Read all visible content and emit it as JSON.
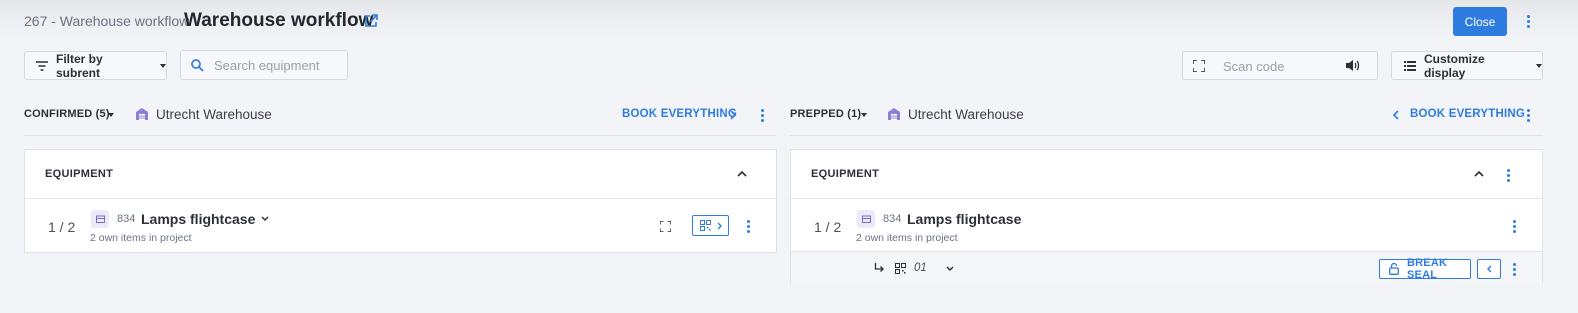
{
  "header": {
    "breadcrumb": "267 - Warehouse workflow",
    "title": "Warehouse workflow",
    "close_label": "Close"
  },
  "toolbar": {
    "filter_label": "Filter by subrent",
    "search_placeholder": "Search equipment",
    "scan_placeholder": "Scan code",
    "customize_label": "Customize display"
  },
  "confirmed": {
    "status_label": "CONFIRMED (5)",
    "location": "Utrecht Warehouse",
    "book_label": "BOOK EVERYTHING",
    "panel_title": "EQUIPMENT",
    "item": {
      "counter": "1 / 2",
      "number": "834",
      "name": "Lamps flightcase",
      "subtitle": "2 own items in project"
    }
  },
  "prepped": {
    "status_label": "PREPPED (1)",
    "location": "Utrecht Warehouse",
    "book_label": "BOOK EVERYTHING",
    "panel_title": "EQUIPMENT",
    "item": {
      "counter": "1 / 2",
      "number": "834",
      "name": "Lamps flightcase",
      "subtitle": "2 own items in project"
    },
    "subitem": {
      "code": "01",
      "seal_label": "BREAK SEAL"
    }
  },
  "colors": {
    "accent": "#2f7ce0",
    "background": "#f2f4f8",
    "item_icon": "#7b6cc9"
  }
}
